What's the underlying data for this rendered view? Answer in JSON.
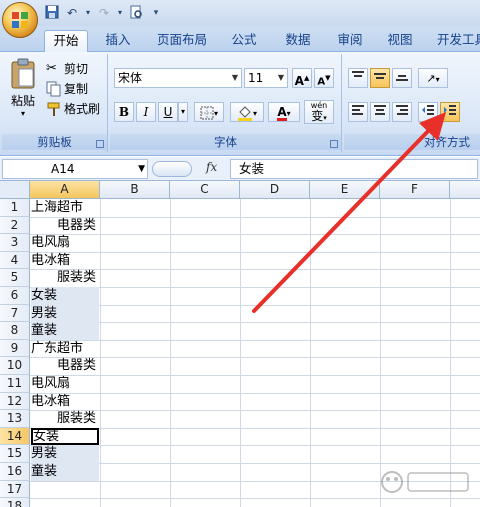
{
  "quick_access": {
    "icons": [
      "save-icon",
      "undo-icon",
      "redo-icon",
      "print-preview-icon",
      "customize-icon"
    ]
  },
  "tabs": [
    {
      "label": "开始",
      "active": true
    },
    {
      "label": "插入",
      "active": false
    },
    {
      "label": "页面布局",
      "active": false
    },
    {
      "label": "公式",
      "active": false
    },
    {
      "label": "数据",
      "active": false
    },
    {
      "label": "审阅",
      "active": false
    },
    {
      "label": "视图",
      "active": false
    },
    {
      "label": "开发工具",
      "active": false
    }
  ],
  "clipboard": {
    "paste_label": "粘贴",
    "cut_label": "剪切",
    "copy_label": "复制",
    "format_painter_label": "格式刷",
    "group_label": "剪贴板"
  },
  "font": {
    "font_name": "宋体",
    "font_size": "11",
    "bold": "B",
    "italic": "I",
    "underline": "U",
    "phonetic": "wén",
    "phonetic_char": "变",
    "grow": "A",
    "shrink": "A",
    "font_color_letter": "A",
    "group_label": "字体",
    "font_color": "#e01b1b",
    "fill_color": "#f5d31c"
  },
  "alignment": {
    "group_label": "对齐方式"
  },
  "formula_bar": {
    "name_box": "A14",
    "fx": "fx",
    "content": "女装"
  },
  "grid": {
    "columns": [
      "A",
      "B",
      "C",
      "D",
      "E",
      "F"
    ],
    "rows": [
      {
        "n": "1",
        "a": "上海超市",
        "indent": false
      },
      {
        "n": "2",
        "a": "电器类",
        "indent": true
      },
      {
        "n": "3",
        "a": "电风扇",
        "indent": false
      },
      {
        "n": "4",
        "a": "电冰箱",
        "indent": false
      },
      {
        "n": "5",
        "a": "服装类",
        "indent": true
      },
      {
        "n": "6",
        "a": "女装",
        "indent": false
      },
      {
        "n": "7",
        "a": "男装",
        "indent": false
      },
      {
        "n": "8",
        "a": "童装",
        "indent": false
      },
      {
        "n": "9",
        "a": "广东超市",
        "indent": false
      },
      {
        "n": "10",
        "a": "电器类",
        "indent": true
      },
      {
        "n": "11",
        "a": "电风扇",
        "indent": false
      },
      {
        "n": "12",
        "a": "电冰箱",
        "indent": false
      },
      {
        "n": "13",
        "a": "服装类",
        "indent": true
      },
      {
        "n": "14",
        "a": "女装",
        "indent": false
      },
      {
        "n": "15",
        "a": "男装",
        "indent": false
      },
      {
        "n": "16",
        "a": "童装",
        "indent": false
      },
      {
        "n": "17",
        "a": "",
        "indent": false
      },
      {
        "n": "18",
        "a": "",
        "indent": false
      }
    ]
  },
  "colors": {
    "arrow": "#e8302a",
    "selected_header": "#f6c766",
    "accent": "#15428b"
  }
}
